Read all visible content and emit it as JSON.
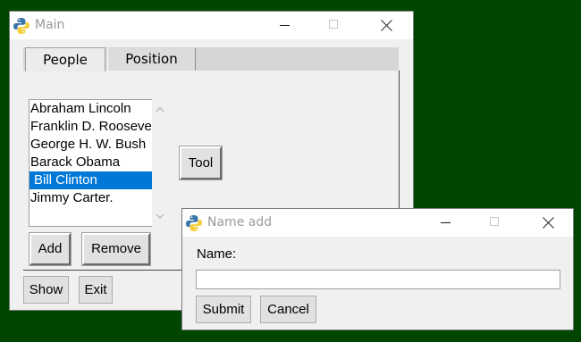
{
  "main_window": {
    "title": "Main",
    "tabs": [
      {
        "label": "People",
        "active": true
      },
      {
        "label": "Position",
        "active": false
      }
    ],
    "people_list": [
      {
        "label": "Abraham Lincoln",
        "selected": false
      },
      {
        "label": "Franklin D. Roosevelt",
        "selected": false
      },
      {
        "label": "George H. W. Bush",
        "selected": false
      },
      {
        "label": "Barack Obama",
        "selected": false
      },
      {
        "label": "Bill Clinton",
        "selected": true
      },
      {
        "label": "Jimmy Carter.",
        "selected": false
      }
    ],
    "buttons": {
      "add": "Add",
      "remove": "Remove",
      "tool": "Tool",
      "show": "Show",
      "exit": "Exit"
    }
  },
  "name_add_window": {
    "title": "Name add",
    "name_label": "Name:",
    "name_value": "",
    "buttons": {
      "submit": "Submit",
      "cancel": "Cancel"
    }
  },
  "colors": {
    "desktop": "#004500",
    "selection": "#0078d7",
    "window_bg": "#f0f0f0"
  },
  "icons": [
    "python-icon",
    "minimize-icon",
    "maximize-icon",
    "close-icon",
    "scroll-up-icon",
    "scroll-down-icon"
  ]
}
